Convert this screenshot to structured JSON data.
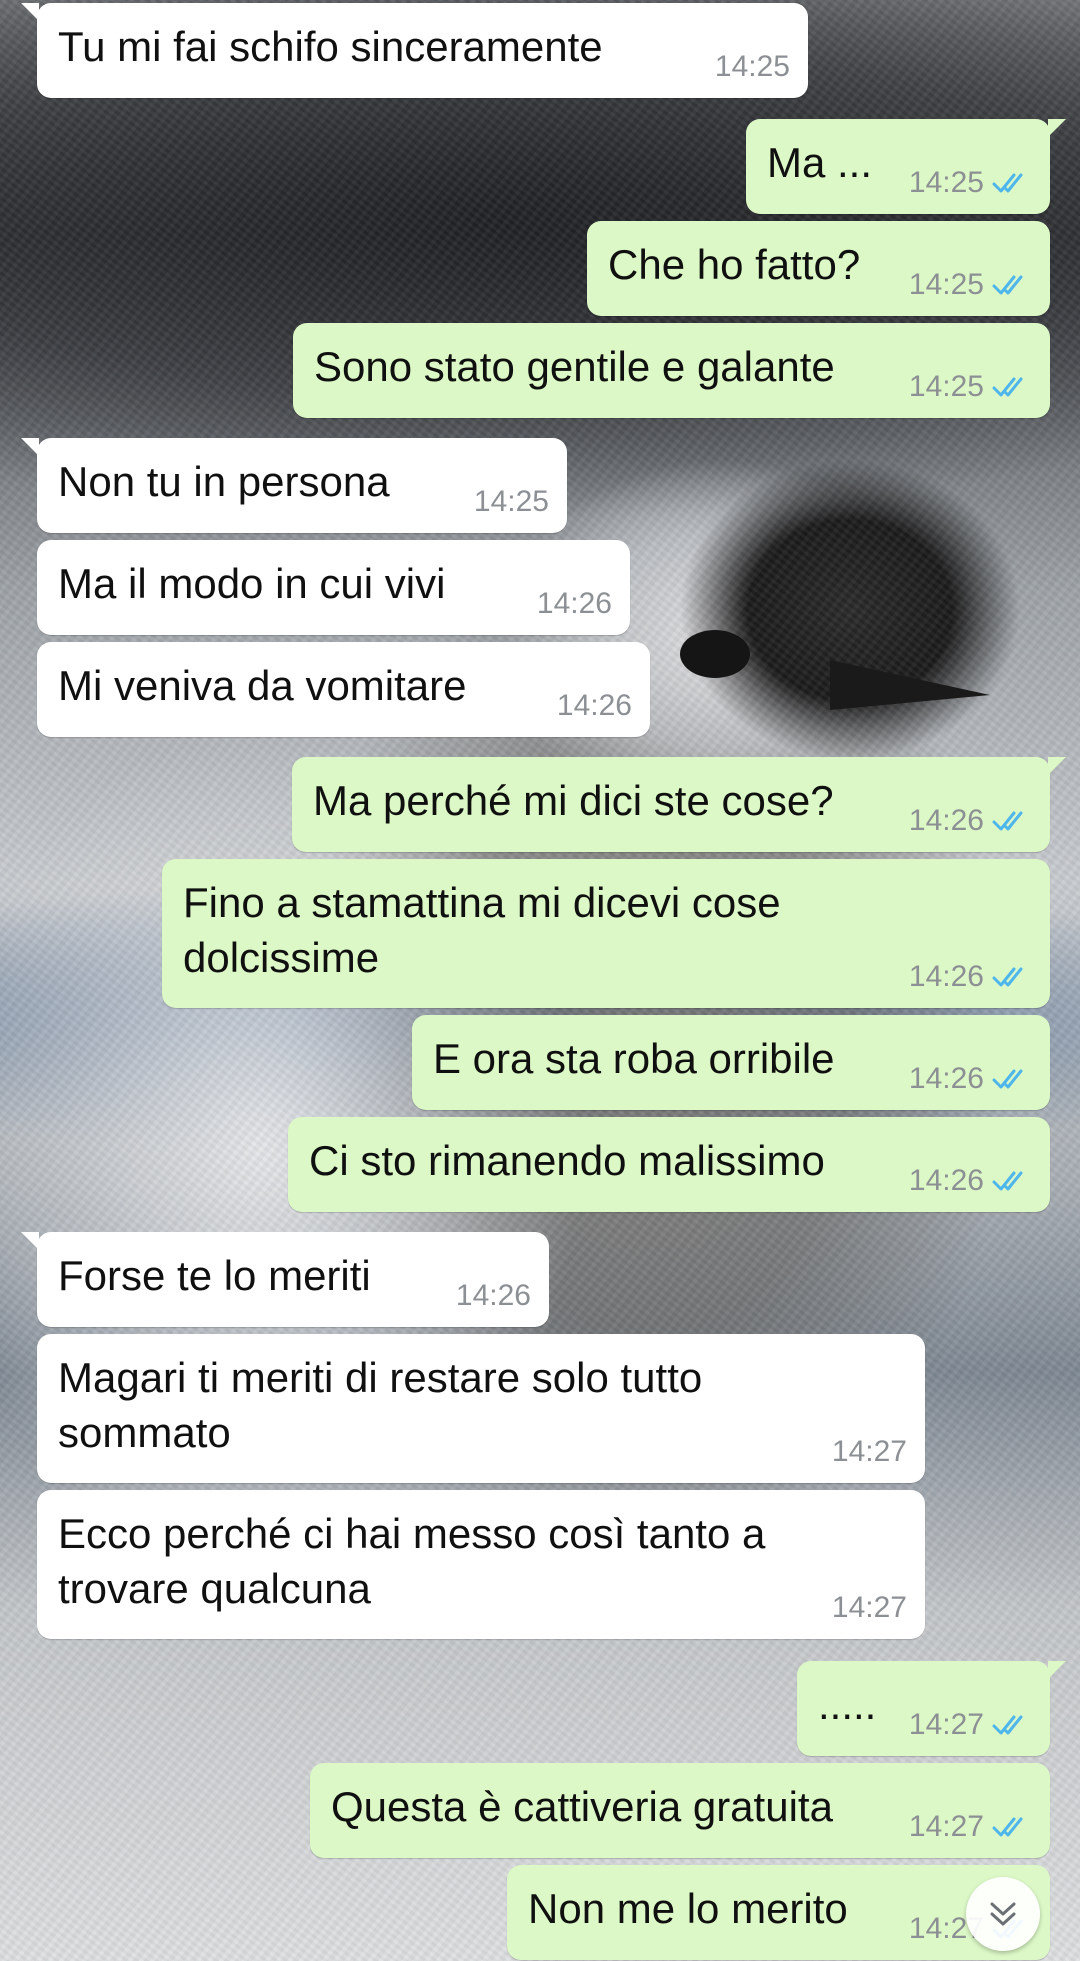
{
  "chat": {
    "messages": [
      {
        "dir": "in",
        "text": "Tu mi fai schifo sinceramente",
        "time": "14:25"
      },
      {
        "dir": "out",
        "text": "Ma ...",
        "time": "14:25",
        "ticks": "read"
      },
      {
        "dir": "out",
        "text": "Che ho fatto?",
        "time": "14:25",
        "ticks": "read"
      },
      {
        "dir": "out",
        "text": "Sono stato gentile e galante",
        "time": "14:25",
        "ticks": "read"
      },
      {
        "dir": "in",
        "text": "Non tu in persona",
        "time": "14:25"
      },
      {
        "dir": "in",
        "text": "Ma il modo in cui vivi",
        "time": "14:26"
      },
      {
        "dir": "in",
        "text": "Mi veniva da vomitare",
        "time": "14:26"
      },
      {
        "dir": "out",
        "text": "Ma perché mi dici ste cose?",
        "time": "14:26",
        "ticks": "read"
      },
      {
        "dir": "out",
        "text": "Fino a stamattina mi dicevi cose dolcissime",
        "time": "14:26",
        "ticks": "read"
      },
      {
        "dir": "out",
        "text": "E ora sta roba orribile",
        "time": "14:26",
        "ticks": "read"
      },
      {
        "dir": "out",
        "text": "Ci sto rimanendo malissimo",
        "time": "14:26",
        "ticks": "read"
      },
      {
        "dir": "in",
        "text": "Forse te lo meriti",
        "time": "14:26"
      },
      {
        "dir": "in",
        "text": "Magari ti meriti di restare solo tutto sommato",
        "time": "14:27"
      },
      {
        "dir": "in",
        "text": "Ecco perché ci hai messo così tanto a trovare qualcuna",
        "time": "14:27"
      },
      {
        "dir": "out",
        "text": ".....",
        "time": "14:27",
        "ticks": "read"
      },
      {
        "dir": "out",
        "text": "Questa è cattiveria gratuita",
        "time": "14:27",
        "ticks": "read"
      },
      {
        "dir": "out",
        "text": "Non me lo merito",
        "time": "14:27",
        "ticks": "read"
      }
    ]
  },
  "colors": {
    "incoming_bubble": "#ffffff",
    "outgoing_bubble": "#dcf8c6",
    "read_ticks": "#4fb6ec",
    "timestamp": "#8c9094"
  },
  "scroll_button": {
    "icon": "double-chevron-down-icon"
  }
}
